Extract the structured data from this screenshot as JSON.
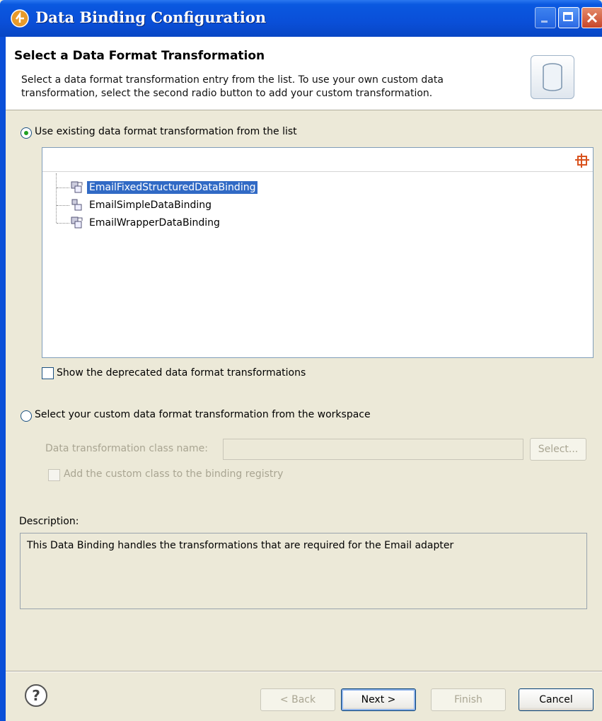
{
  "window": {
    "title": "Data Binding Configuration"
  },
  "banner": {
    "title": "Select a Data Format Transformation",
    "description": "Select a data format transformation entry from the list.  To use your own custom data transformation, select the second radio button to add your custom transformation."
  },
  "options": {
    "existing_label": "Use existing data format transformation from the list",
    "existing_checked": true,
    "custom_label": "Select your custom data format transformation from the workspace",
    "custom_checked": false
  },
  "tree": {
    "items": [
      {
        "label": "EmailFixedStructuredDataBinding",
        "selected": true,
        "icon": "databinding-icon"
      },
      {
        "label": "EmailSimpleDataBinding",
        "selected": false,
        "icon": "databinding-simple-icon"
      },
      {
        "label": "EmailWrapperDataBinding",
        "selected": false,
        "icon": "databinding-icon"
      }
    ]
  },
  "deprecated": {
    "label": "Show the deprecated data format transformations",
    "checked": false
  },
  "custom": {
    "class_name_label": "Data transformation class name:",
    "class_name_value": "",
    "select_button": "Select...",
    "registry_label": "Add the custom class to the binding registry"
  },
  "description": {
    "label": "Description:",
    "text": "This Data Binding handles the transformations that are required for the Email adapter"
  },
  "buttons": {
    "back": "< Back",
    "next": "Next >",
    "finish": "Finish",
    "cancel": "Cancel"
  },
  "colors": {
    "titlebar": "#0a4fd8",
    "dialog_bg": "#ece9d8",
    "selection": "#316ac5"
  }
}
